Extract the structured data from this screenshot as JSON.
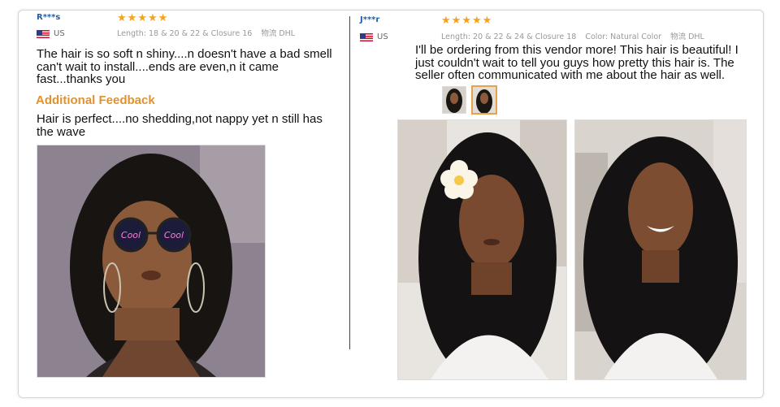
{
  "colors": {
    "accent": "#f7a21b",
    "name": "#1f5fa8",
    "feedback": "#e0922e",
    "meta": "#999999"
  },
  "reviews": [
    {
      "reviewer": "R***s",
      "country": "US",
      "rating": 5,
      "meta": {
        "length_label": "Length:",
        "length_value": "18 & 20 & 22 & Closure 16",
        "shipping_label": "物流",
        "shipping_value": "DHL"
      },
      "text": "The hair is so soft n shiny....n doesn't have a bad smell can't wait to install....ends are even,n it came fast...thanks you",
      "additional_title": "Additional Feedback",
      "additional_text": "Hair is perfect....no shedding,not nappy yet n still has the wave"
    },
    {
      "reviewer": "J***r",
      "country": "US",
      "rating": 5,
      "meta": {
        "length_label": "Length:",
        "length_value": "20 & 22 & 24 & Closure 18",
        "color_label": "Color:",
        "color_value": "Natural Color",
        "shipping_label": "物流",
        "shipping_value": "DHL"
      },
      "text": "I'll be ordering from this vendor more! This hair is beautiful!  I just couldn't wait to tell you guys how pretty this hair is. The seller often communicated with me about the hair as well."
    }
  ]
}
